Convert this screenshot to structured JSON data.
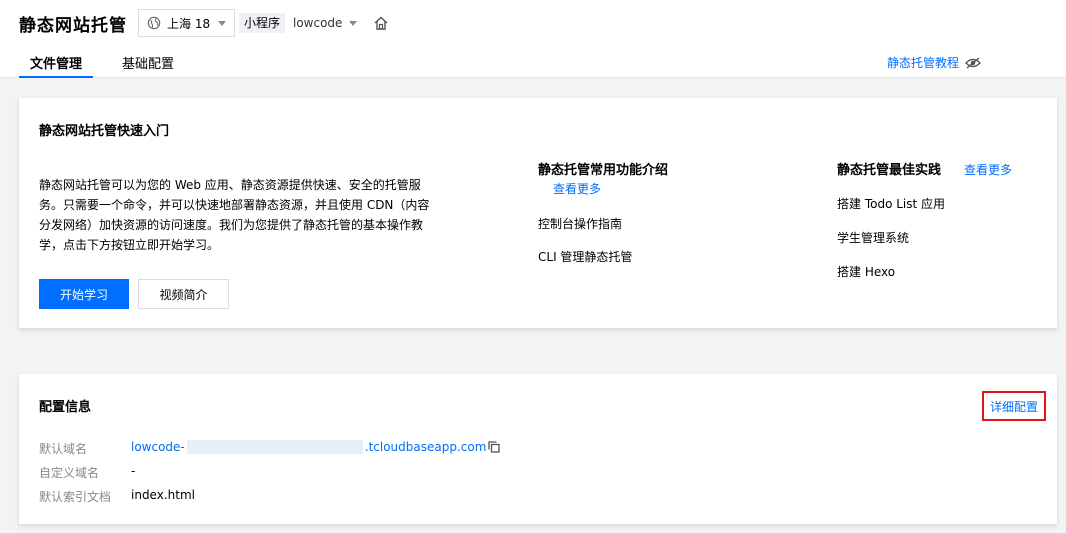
{
  "header": {
    "app_title": "静态网站托管",
    "region": "上海 18",
    "env_tag": "小程序",
    "env_name": "lowcode"
  },
  "tabs": [
    {
      "label": "文件管理",
      "active": true
    },
    {
      "label": "基础配置",
      "active": false
    }
  ],
  "tutorial_link": "静态托管教程",
  "quickstart": {
    "title": "静态网站托管快速入门",
    "intro": "静态网站托管可以为您的 Web 应用、静态资源提供快速、安全的托管服务。只需要一个命令，并可以快速地部署静态资源，并且使用 CDN（内容分发网络）加快资源的访问速度。我们为您提供了静态托管的基本操作教学，点击下方按钮立即开始学习。",
    "start_button": "开始学习",
    "video_button": "视频简介",
    "features": {
      "title": "静态托管常用功能介绍",
      "more": "查看更多",
      "items": [
        "控制台操作指南",
        "CLI 管理静态托管"
      ]
    },
    "practices": {
      "title": "静态托管最佳实践",
      "more": "查看更多",
      "items": [
        "搭建 Todo List 应用",
        "学生管理系统",
        "搭建 Hexo"
      ]
    }
  },
  "config": {
    "title": "配置信息",
    "detail_button": "详细配置",
    "default_domain_label": "默认域名",
    "default_domain_prefix": "lowcode-",
    "default_domain_suffix": ".tcloudbaseapp.com",
    "custom_domain_label": "自定义域名",
    "custom_domain_value": "-",
    "index_doc_label": "默认索引文档",
    "index_doc_value": "index.html"
  },
  "colors": {
    "accent": "#006eff",
    "highlight_border": "#e1141a"
  }
}
